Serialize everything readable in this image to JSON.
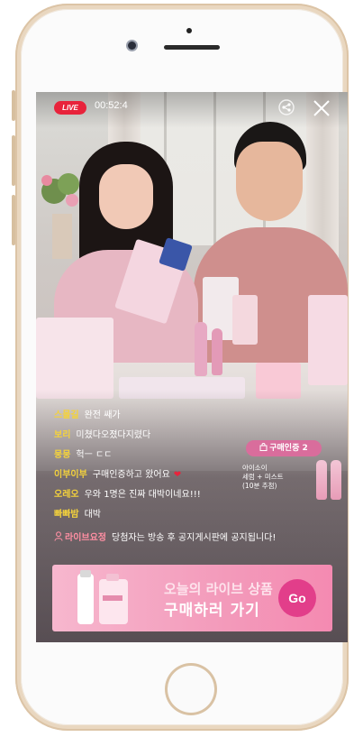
{
  "live_badge": "LIVE",
  "timer": "00:52:4",
  "chat": [
    {
      "user": "스몰길",
      "message": "완전 쌔가"
    },
    {
      "user": "보리",
      "message": "미쳤다오졌다지렸다"
    },
    {
      "user": "뭉뭉",
      "message": "헉ㅡ ㄷㄷ"
    },
    {
      "user": "이부이부",
      "message": "구매인증하고 왔어요",
      "heart": "❤"
    },
    {
      "user": "오레오",
      "message": "우와 1명은 진짜 대박이네요!!!"
    },
    {
      "user": "빠빠밤",
      "message": "대박"
    }
  ],
  "notice": {
    "user": "라이브요정",
    "message": "당첨자는 방송 후 공지게시판에 공지됩니다!"
  },
  "buy_tag": "구매인증 2",
  "product_card": {
    "name_line1": "아이소이",
    "name_line2": "세럼 + 미스트",
    "name_line3": "(10분 추첨)"
  },
  "banner": {
    "line1": "오늘의 라이브 상품",
    "line2": "구매하러 가기",
    "go_label": "Go"
  },
  "colors": {
    "live_red": "#e8233b",
    "chat_user": "#f4d23c",
    "banner_pink": "#f39bbb",
    "go_button": "#e23e8a"
  }
}
